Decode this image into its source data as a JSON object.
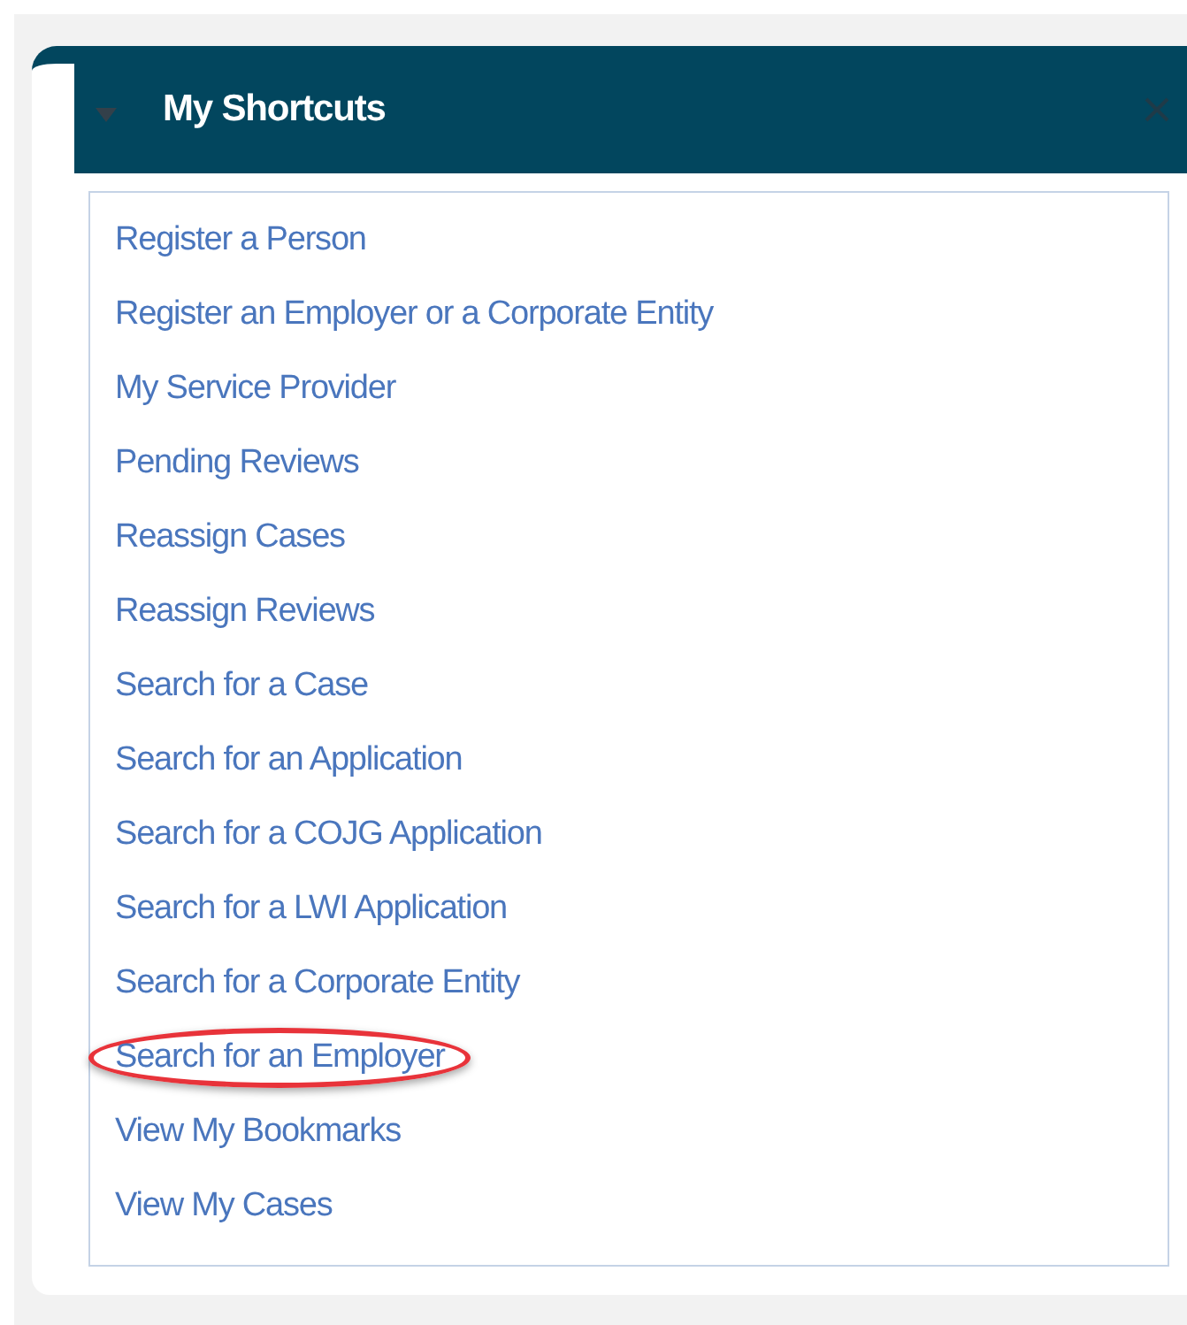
{
  "panel": {
    "title": "My Shortcuts"
  },
  "shortcuts": [
    {
      "label": "Register a Person",
      "highlighted": false
    },
    {
      "label": "Register an Employer or a Corporate Entity",
      "highlighted": false
    },
    {
      "label": "My Service Provider",
      "highlighted": false
    },
    {
      "label": "Pending Reviews",
      "highlighted": false
    },
    {
      "label": "Reassign Cases",
      "highlighted": false
    },
    {
      "label": "Reassign Reviews",
      "highlighted": false
    },
    {
      "label": "Search for a Case",
      "highlighted": false
    },
    {
      "label": "Search for an Application",
      "highlighted": false
    },
    {
      "label": "Search for a COJG Application",
      "highlighted": false
    },
    {
      "label": "Search for a LWI Application",
      "highlighted": false
    },
    {
      "label": "Search for a Corporate Entity",
      "highlighted": false
    },
    {
      "label": "Search for an Employer",
      "highlighted": true
    },
    {
      "label": "View My Bookmarks",
      "highlighted": false
    },
    {
      "label": "View My Cases",
      "highlighted": false
    }
  ]
}
